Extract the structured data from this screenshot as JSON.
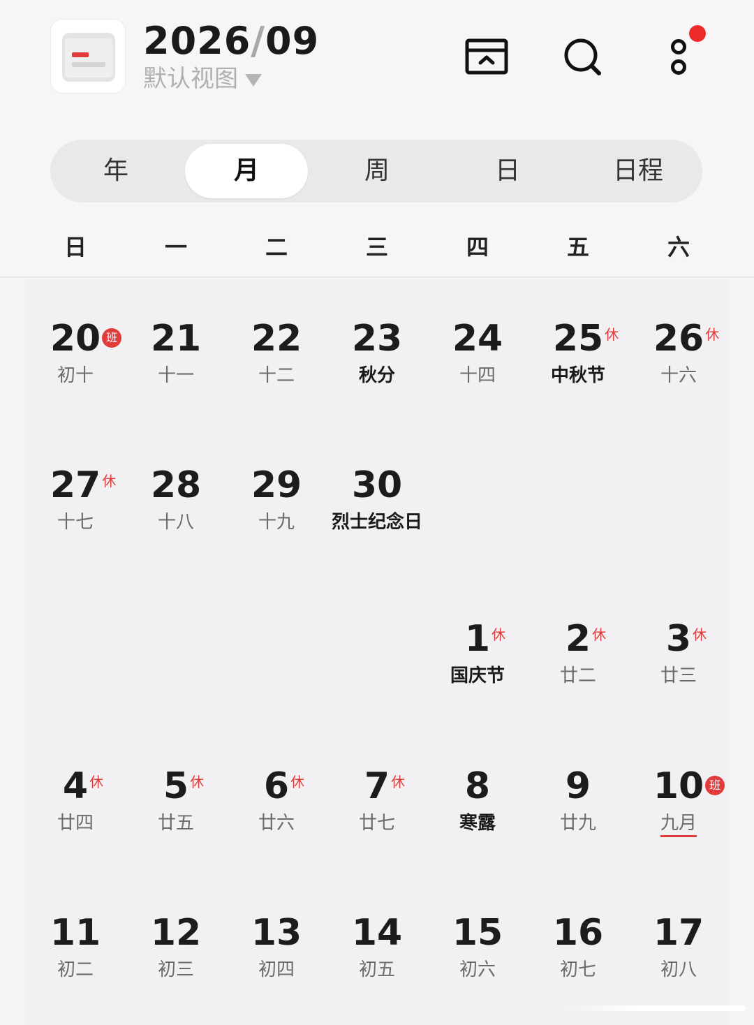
{
  "header": {
    "title_year": "2026",
    "title_sep": "/",
    "title_month": "09",
    "view_label": "默认视图",
    "icons": [
      "today-card-icon",
      "search-icon",
      "more-options-icon"
    ],
    "accent_color": "#e23b3b"
  },
  "tabs": [
    "年",
    "月",
    "周",
    "日",
    "日程"
  ],
  "active_tab": "月",
  "weekdays": [
    "日",
    "一",
    "二",
    "三",
    "四",
    "五",
    "六"
  ],
  "weeks": [
    [
      {
        "day": "20",
        "lunar": "初十",
        "tag": "班"
      },
      {
        "day": "21",
        "lunar": "十一"
      },
      {
        "day": "22",
        "lunar": "十二"
      },
      {
        "day": "23",
        "lunar": "秋分",
        "strong": true
      },
      {
        "day": "24",
        "lunar": "十四"
      },
      {
        "day": "25",
        "lunar": "中秋节",
        "tag": "休",
        "strong": true
      },
      {
        "day": "26",
        "lunar": "十六",
        "tag": "休"
      }
    ],
    [
      {
        "day": "27",
        "lunar": "十七",
        "tag": "休"
      },
      {
        "day": "28",
        "lunar": "十八"
      },
      {
        "day": "29",
        "lunar": "十九"
      },
      {
        "day": "30",
        "lunar": "烈士纪念日",
        "strong": true
      },
      null,
      null,
      null
    ],
    [
      null,
      null,
      null,
      null,
      {
        "day": "1",
        "lunar": "国庆节",
        "tag": "休",
        "strong": true
      },
      {
        "day": "2",
        "lunar": "廿二",
        "tag": "休"
      },
      {
        "day": "3",
        "lunar": "廿三",
        "tag": "休"
      }
    ],
    [
      {
        "day": "4",
        "lunar": "廿四",
        "tag": "休"
      },
      {
        "day": "5",
        "lunar": "廿五",
        "tag": "休"
      },
      {
        "day": "6",
        "lunar": "廿六",
        "tag": "休"
      },
      {
        "day": "7",
        "lunar": "廿七",
        "tag": "休"
      },
      {
        "day": "8",
        "lunar": "寒露",
        "strong": true
      },
      {
        "day": "9",
        "lunar": "廿九"
      },
      {
        "day": "10",
        "lunar": "九月",
        "tag": "班",
        "month": true
      }
    ],
    [
      {
        "day": "11",
        "lunar": "初二"
      },
      {
        "day": "12",
        "lunar": "初三"
      },
      {
        "day": "13",
        "lunar": "初四"
      },
      {
        "day": "14",
        "lunar": "初五"
      },
      {
        "day": "15",
        "lunar": "初六"
      },
      {
        "day": "16",
        "lunar": "初七"
      },
      {
        "day": "17",
        "lunar": "初八"
      }
    ]
  ]
}
